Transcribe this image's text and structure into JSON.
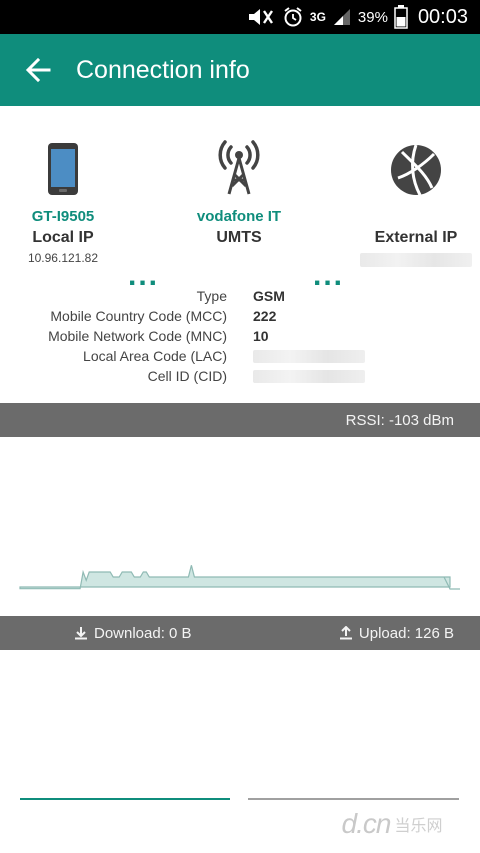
{
  "status_bar": {
    "network": "3G",
    "battery": "39%",
    "time": "00:03"
  },
  "app_bar": {
    "title": "Connection info"
  },
  "connection": {
    "device": {
      "name": "GT-I9505",
      "label": "Local IP",
      "address": "10.96.121.82"
    },
    "carrier": {
      "name": "vodafone IT",
      "label": "UMTS"
    },
    "external": {
      "label": "External IP"
    }
  },
  "cell_info": [
    {
      "key": "Type",
      "value": "GSM"
    },
    {
      "key": "Mobile Country Code (MCC)",
      "value": "222"
    },
    {
      "key": "Mobile Network Code (MNC)",
      "value": "10"
    },
    {
      "key": "Local Area Code (LAC)",
      "value": ""
    },
    {
      "key": "Cell ID (CID)",
      "value": ""
    }
  ],
  "rssi": {
    "text": "RSSI: -103 dBm"
  },
  "signal_history": [
    -104,
    -104,
    -104,
    -104,
    -104,
    -104,
    -104,
    -104,
    -104,
    -104,
    -104,
    -104,
    -104,
    -104,
    -104,
    -104,
    -104,
    -104,
    -104,
    -104,
    -104,
    -103,
    -103.5,
    -103,
    -103,
    -103,
    -103,
    -103,
    -103,
    -103,
    -103,
    -103.3,
    -103.3,
    -103.3,
    -103,
    -103,
    -103,
    -103,
    -103.3,
    -103.3,
    -103.3,
    -103,
    -103,
    -103.3,
    -103.3,
    -103.3,
    -103.3,
    -103.3,
    -103.3,
    -103.3,
    -103.3,
    -103.3,
    -103.3,
    -103.3,
    -103.3,
    -103.3,
    -103.3,
    -102.6,
    -103.3,
    -103.3,
    -103.3,
    -103.3,
    -103.3,
    -103.3,
    -103.3,
    -103.3,
    -103.3,
    -103.3,
    -103.3,
    -103.3,
    -103.3,
    -103.3,
    -103.3,
    -103.3,
    -103.3,
    -103.3,
    -103.3,
    -103.3,
    -103.3,
    -103.3,
    -103.3,
    -103.3,
    -103.3,
    -103.3,
    -103.3,
    -103.3,
    -103.3,
    -103.3,
    -103.3,
    -103.3,
    -103.3,
    -103.3,
    -103.3,
    -103.3,
    -103.3,
    -103.3,
    -103.3,
    -103.3,
    -103.3,
    -103.3,
    -103.3,
    -103.3,
    -103.3,
    -103.3,
    -103.3,
    -103.3,
    -103.3,
    -103.3,
    -103.3,
    -103.3,
    -103.3,
    -103.3,
    -103.3,
    -103.3,
    -103.3,
    -103.3,
    -103.3,
    -103.3,
    -103.3,
    -103.3,
    -103.3,
    -103.3,
    -103.3,
    -103.3,
    -103.3,
    -103.3,
    -103.3,
    -103.3,
    -103.3,
    -103.3,
    -103.3,
    -103.3,
    -103.3,
    -103.3,
    -103.3,
    -103.3,
    -103.3,
    -103.3,
    -103.3,
    -103.3,
    -103.3,
    -103.3,
    -103.3,
    -103.3
  ],
  "traffic": {
    "download": "Download: 0 B",
    "upload": "Upload: 126 B"
  },
  "colors": {
    "accent": "#0f8d7c",
    "signal_fill": "#cfe6e2",
    "signal_line": "#8fbab4",
    "bar_bg": "#6b6b6b",
    "upload_line": "#a0a0a0"
  },
  "watermark": {
    "brand": "d.cn",
    "cn": "当乐网"
  }
}
